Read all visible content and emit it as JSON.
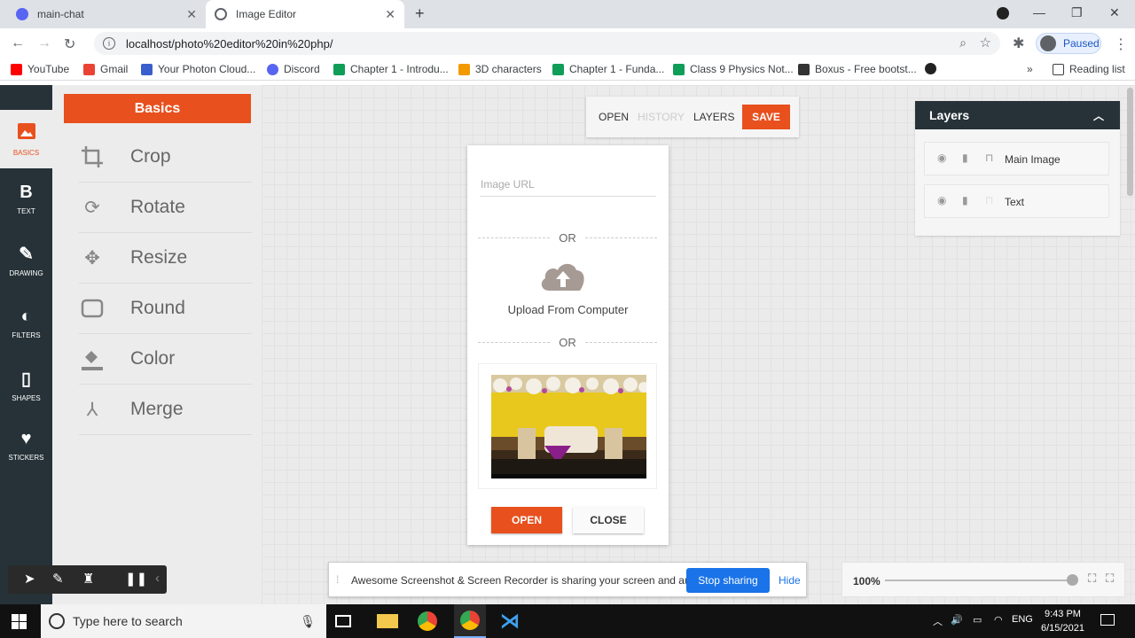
{
  "browser": {
    "tabs": [
      {
        "label": "main-chat",
        "favicon_color": "#5865f2"
      },
      {
        "label": "Image Editor",
        "favicon_color": "#5f6368"
      }
    ],
    "url": "localhost/photo%20editor%20in%20php/",
    "profile_status": "Paused",
    "bookmarks": [
      "YouTube",
      "Gmail",
      "Your Photon Cloud...",
      "Discord",
      "Chapter 1 - Introdu...",
      "3D characters",
      "Chapter 1 - Funda...",
      "Class 9 Physics Not...",
      "Boxus - Free bootst..."
    ],
    "reading_list": "Reading list"
  },
  "editor": {
    "nav": [
      {
        "label": "BASICS",
        "icon": "image-icon"
      },
      {
        "label": "TEXT",
        "icon": "bold-text-icon"
      },
      {
        "label": "DRAWING",
        "icon": "brush-icon"
      },
      {
        "label": "FILTERS",
        "icon": "filter-icon"
      },
      {
        "label": "SHAPES",
        "icon": "shape-icon"
      },
      {
        "label": "STICKERS",
        "icon": "heart-icon"
      }
    ],
    "panel_title": "Basics",
    "tools": [
      {
        "label": "Crop",
        "icon": "crop-icon"
      },
      {
        "label": "Rotate",
        "icon": "rotate-icon"
      },
      {
        "label": "Resize",
        "icon": "resize-icon"
      },
      {
        "label": "Round",
        "icon": "round-icon"
      },
      {
        "label": "Color",
        "icon": "fill-color-icon"
      },
      {
        "label": "Merge",
        "icon": "merge-icon"
      }
    ],
    "topbar": {
      "open": "OPEN",
      "history": "HISTORY",
      "layers": "LAYERS",
      "save": "SAVE"
    },
    "dialog": {
      "url_placeholder": "Image URL",
      "or_label": "OR",
      "upload_label": "Upload From Computer",
      "open_button": "OPEN",
      "close_button": "CLOSE"
    },
    "layers_panel": {
      "title": "Layers",
      "items": [
        "Main Image",
        "Text"
      ]
    },
    "zoom": "100%",
    "zoom_fraction": 1.0,
    "share_bar": {
      "text": "Awesome Screenshot & Screen Recorder is sharing your screen and audio.",
      "stop_button": "Stop sharing",
      "hide_button": "Hide"
    }
  },
  "taskbar": {
    "search_placeholder": "Type here to search",
    "language": "ENG",
    "time": "9:43 PM",
    "date": "6/15/2021"
  },
  "colors": {
    "accent": "#e8501e",
    "nav_bg": "#263238",
    "link": "#1a73e8"
  }
}
